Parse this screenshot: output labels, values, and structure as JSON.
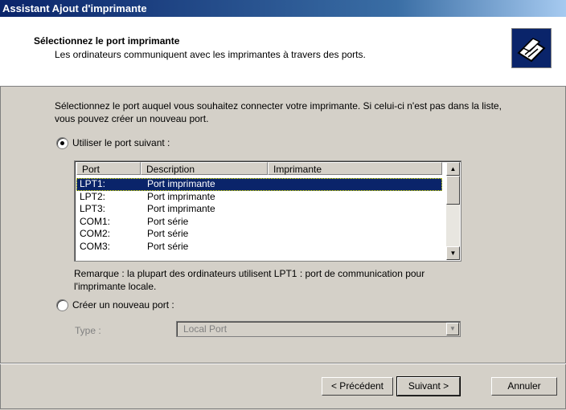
{
  "window": {
    "title": "Assistant Ajout d'imprimante"
  },
  "header": {
    "title": "Sélectionnez le port imprimante",
    "subtitle": "Les ordinateurs communiquent avec les imprimantes à travers des ports.",
    "icon": "printer-icon"
  },
  "intro": "Sélectionnez le port auquel vous souhaitez connecter votre imprimante. Si celui-ci n'est pas dans la liste, vous pouvez créer un nouveau port.",
  "options": {
    "use_existing": {
      "label": "Utiliser le port suivant :",
      "checked": true
    },
    "create_new": {
      "label": "Créer un nouveau port :",
      "checked": false
    }
  },
  "ports": {
    "columns": [
      "Port",
      "Description",
      "Imprimante"
    ],
    "rows": [
      {
        "port": "LPT1:",
        "description": "Port imprimante",
        "printer": ""
      },
      {
        "port": "LPT2:",
        "description": "Port imprimante",
        "printer": ""
      },
      {
        "port": "LPT3:",
        "description": "Port imprimante",
        "printer": ""
      },
      {
        "port": "COM1:",
        "description": "Port série",
        "printer": ""
      },
      {
        "port": "COM2:",
        "description": "Port série",
        "printer": ""
      },
      {
        "port": "COM3:",
        "description": "Port série",
        "printer": ""
      }
    ],
    "selected_index": 0
  },
  "remark": "Remarque : la plupart des ordinateurs utilisent LPT1 : port de communication pour l'imprimante locale.",
  "type": {
    "label": "Type :",
    "value": "Local Port"
  },
  "buttons": {
    "back": "< Précédent",
    "next": "Suivant >",
    "cancel": "Annuler"
  },
  "colors": {
    "titlebar": "#0a246a",
    "selection": "#0a246a",
    "face": "#d4d0c8"
  }
}
